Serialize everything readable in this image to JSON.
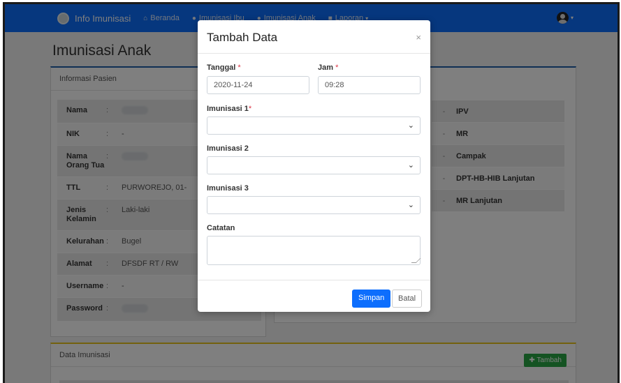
{
  "navbar": {
    "brand": "Info Imunisasi",
    "links": [
      {
        "label": "Beranda",
        "icon": "home-icon"
      },
      {
        "label": "Imunisasi Ibu",
        "icon": "user-icon"
      },
      {
        "label": "Imunisasi Anak",
        "icon": "child-icon"
      },
      {
        "label": "Laporan",
        "icon": "report-icon"
      }
    ],
    "caret": "▾"
  },
  "page": {
    "title": "Imunisasi Anak"
  },
  "pasien_card": {
    "header": "Informasi Pasien",
    "rows": [
      {
        "key": "Nama",
        "value": ""
      },
      {
        "key": "NIK",
        "value": "-"
      },
      {
        "key": "Nama Orang Tua",
        "value": ""
      },
      {
        "key": "TTL",
        "value": "PURWOREJO, 01-"
      },
      {
        "key": "Jenis Kelamin",
        "value": "Laki-laki"
      },
      {
        "key": "Kelurahan",
        "value": "Bugel"
      },
      {
        "key": "Alamat",
        "value": "DFSDF RT / RW"
      },
      {
        "key": "Username",
        "value": "-"
      },
      {
        "key": "Password",
        "value": ""
      }
    ],
    "colon": ":"
  },
  "imunisasi_card": {
    "rows": [
      "IPV",
      "MR",
      "Campak",
      "DPT-HB-HIB Lanjutan",
      "MR Lanjutan"
    ],
    "dash": "-"
  },
  "data_card": {
    "header": "Data Imunisasi",
    "tambah_label": "Tambah"
  },
  "modal": {
    "title": "Tambah Data",
    "close": "×",
    "tanggal_label": "Tanggal",
    "tanggal_value": "2020-11-24",
    "jam_label": "Jam",
    "jam_value": "09:28",
    "required_mark": "*",
    "imunisasi1_label": "Imunisasi 1",
    "imunisasi2_label": "Imunisasi 2",
    "imunisasi3_label": "Imunisasi 3",
    "catatan_label": "Catatan",
    "simpan_label": "Simpan",
    "batal_label": "Batal",
    "chevron": "⌄"
  },
  "colors": {
    "navbar": "#0d6efd",
    "primary_button": "#0d6efd",
    "success_button": "#28a745",
    "required": "#dc3545",
    "card_accent_blue": "#1f5ea8",
    "card_accent_yellow": "#e6c21b"
  }
}
